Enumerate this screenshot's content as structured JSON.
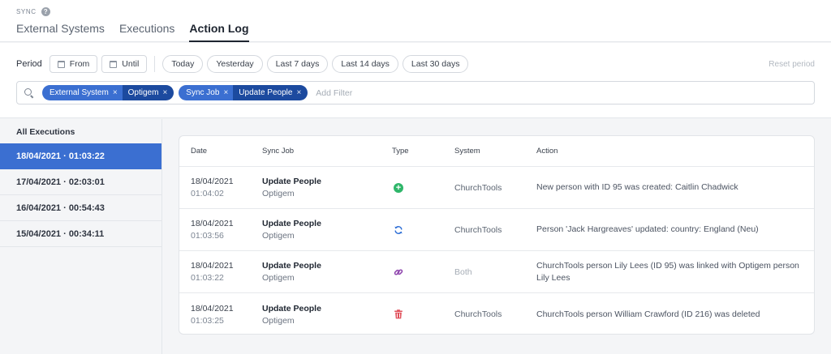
{
  "header": {
    "eyebrow": "SYNC",
    "help_icon": "?",
    "tabs": [
      {
        "label": "External Systems",
        "active": false
      },
      {
        "label": "Executions",
        "active": false
      },
      {
        "label": "Action Log",
        "active": true
      }
    ]
  },
  "period": {
    "label": "Period",
    "from_label": "From",
    "until_label": "Until",
    "presets": [
      "Today",
      "Yesterday",
      "Last 7 days",
      "Last 14 days",
      "Last 30 days"
    ],
    "reset_label": "Reset period"
  },
  "filters": {
    "chips": [
      {
        "key": "External System",
        "value": "Optigem"
      },
      {
        "key": "Sync Job",
        "value": "Update People"
      }
    ],
    "remove_glyph": "×",
    "add_placeholder": "Add Filter"
  },
  "sidebar": {
    "heading": "All Executions",
    "items": [
      {
        "label": "18/04/2021 · 01:03:22",
        "active": true
      },
      {
        "label": "17/04/2021 · 02:03:01",
        "active": false
      },
      {
        "label": "16/04/2021 · 00:54:43",
        "active": false
      },
      {
        "label": "15/04/2021 · 00:34:11",
        "active": false
      }
    ]
  },
  "table": {
    "columns": [
      "Date",
      "Sync Job",
      "Type",
      "System",
      "Action"
    ],
    "rows": [
      {
        "date": "18/04/2021",
        "time": "01:04:02",
        "job": "Update People",
        "job_system": "Optigem",
        "type_icon": "plus-circle-icon",
        "system": "ChurchTools",
        "action": "New person with ID 95 was created: Caitlin Chadwick"
      },
      {
        "date": "18/04/2021",
        "time": "01:03:56",
        "job": "Update People",
        "job_system": "Optigem",
        "type_icon": "refresh-icon",
        "system": "ChurchTools",
        "action": "Person 'Jack Hargreaves' updated: country: England (Neu)"
      },
      {
        "date": "18/04/2021",
        "time": "01:03:22",
        "job": "Update People",
        "job_system": "Optigem",
        "type_icon": "link-icon",
        "system": "Both",
        "action": "ChurchTools person Lily Lees (ID 95) was linked with Optigem person Lily Lees"
      },
      {
        "date": "18/04/2021",
        "time": "01:03:25",
        "job": "Update People",
        "job_system": "Optigem",
        "type_icon": "trash-icon",
        "system": "ChurchTools",
        "action": "ChurchTools person William Crawford (ID 216) was deleted"
      }
    ]
  },
  "colors": {
    "accent": "#3b6fd1",
    "chip_dark": "#1c4a9f",
    "created": "#2fb66a",
    "updated": "#2f6fd6",
    "linked": "#8e44ad",
    "deleted": "#e0505b"
  }
}
